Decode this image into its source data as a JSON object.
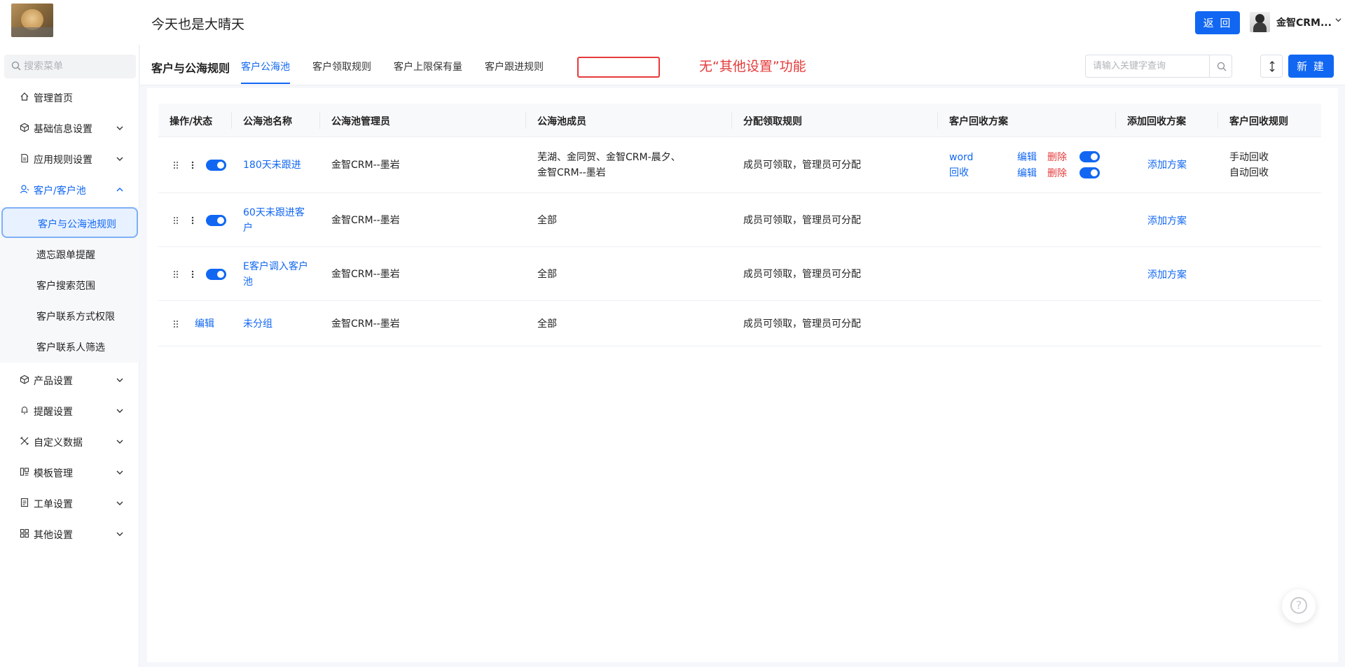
{
  "header": {
    "app_title": "今天也是大晴天",
    "back_label": "返 回",
    "user_name": "金智CRM..."
  },
  "sidebar": {
    "search_placeholder": "搜索菜单",
    "items": [
      {
        "label": "管理首页",
        "icon": "home-icon"
      },
      {
        "label": "基础信息设置",
        "icon": "cube-icon"
      },
      {
        "label": "应用规则设置",
        "icon": "document-icon"
      },
      {
        "label": "客户/客户池",
        "icon": "user-icon"
      },
      {
        "label": "产品设置",
        "icon": "cube-icon"
      },
      {
        "label": "提醒设置",
        "icon": "bell-icon"
      },
      {
        "label": "自定义数据",
        "icon": "tools-icon"
      },
      {
        "label": "模板管理",
        "icon": "template-icon"
      },
      {
        "label": "工单设置",
        "icon": "ticket-icon"
      },
      {
        "label": "其他设置",
        "icon": "grid-icon"
      }
    ],
    "sub_items": [
      "客户与公海池规则",
      "遗忘跟单提醒",
      "客户搜索范围",
      "客户联系方式权限",
      "客户联系人筛选"
    ]
  },
  "tabbar": {
    "page_title": "客户与公海规则",
    "tabs": [
      "客户公海池",
      "客户领取规则",
      "客户上限保有量",
      "客户跟进规则"
    ],
    "annotation": "无“其他设置”功能",
    "search_placeholder": "请输入关键字查询",
    "new_label": "新 建"
  },
  "table": {
    "columns": [
      "操作/状态",
      "公海池名称",
      "公海池管理员",
      "公海池成员",
      "分配领取规则",
      "客户回收方案",
      "添加回收方案",
      "客户回收规则"
    ],
    "rows": [
      {
        "name": "180天未跟进",
        "admin": "金智CRM--墨岩",
        "members": "芜湖、金同贺、金智CRM-晨夕、金智CRM--墨岩",
        "rule": "成员可领取，管理员可分配",
        "plans": [
          {
            "name": "word",
            "edit": "编辑",
            "delete": "删除"
          },
          {
            "name": "回收",
            "edit": "编辑",
            "delete": "删除"
          }
        ],
        "add_plan": "添加方案",
        "recycle_rules": [
          "手动回收",
          "自动回收"
        ]
      },
      {
        "name": "60天未跟进客户",
        "admin": "金智CRM--墨岩",
        "members": "全部",
        "rule": "成员可领取，管理员可分配",
        "add_plan": "添加方案"
      },
      {
        "name": "E客户调入客户池",
        "admin": "金智CRM--墨岩",
        "members": "全部",
        "rule": "成员可领取，管理员可分配",
        "add_plan": "添加方案"
      },
      {
        "action": "编辑",
        "name": "未分组",
        "admin": "金智CRM--墨岩",
        "members": "全部",
        "rule": "成员可领取，管理员可分配"
      }
    ]
  },
  "help_label": "?",
  "colors": {
    "primary": "#1167f2",
    "danger": "#e53a3a",
    "annotation": "#e53a3a"
  }
}
